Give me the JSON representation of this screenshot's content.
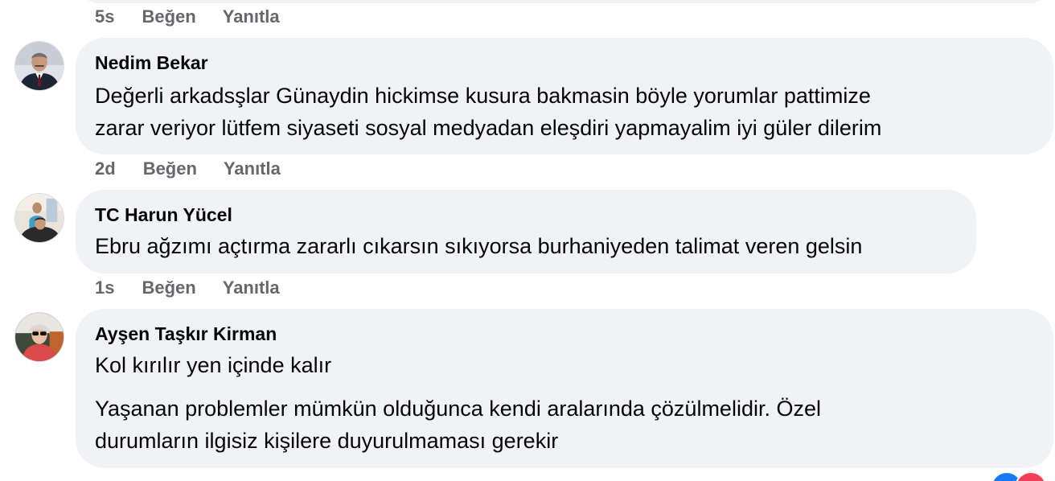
{
  "top_comment": {
    "time": "5s",
    "like_label": "Beğen",
    "reply_label": "Yanıtla"
  },
  "comments": [
    {
      "author": "Nedim Bekar",
      "paragraphs": [
        "Değerli arkadsşlar Günaydin hickimse kusura bakmasin böyle yorumlar pattimize",
        "zarar veriyor lütfem siyaseti sosyal medyadan eleşdiri yapmayalim iyi güler dilerim"
      ],
      "time": "2d",
      "like_label": "Beğen",
      "reply_label": "Yanıtla"
    },
    {
      "author": "TC Harun Yücel",
      "paragraphs": [
        "Ebru ağzımı açtırma zararlı cıkarsın sıkıyorsa burhaniyeden talimat veren gelsin"
      ],
      "time": "1s",
      "like_label": "Beğen",
      "reply_label": "Yanıtla"
    },
    {
      "author": "Ayşen Taşkır Kirman",
      "paragraphs": [
        "Kol kırılır yen içinde kalır",
        "Yaşanan problemler mümkün olduğunca kendi aralarında çözülmelidir. Özel",
        "durumların ilgisiz kişilere duyurulmaması gerekir"
      ]
    }
  ],
  "colors": {
    "bubble": "#f0f2f5",
    "meta_text": "#65676b",
    "body_text": "#050505",
    "like_reaction": "#1877f2",
    "love_reaction": "#f33e58"
  }
}
